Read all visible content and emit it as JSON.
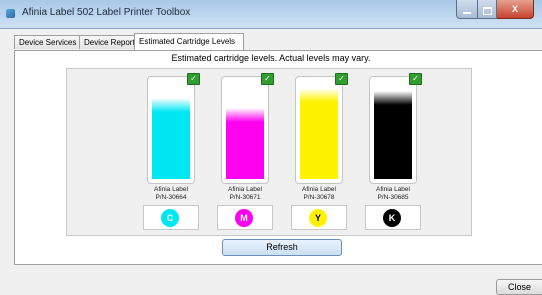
{
  "window": {
    "title": "Afinia Label 502 Label Printer Toolbox",
    "minimize_label": "",
    "maximize_label": "",
    "close_glyph": "X"
  },
  "tabs": [
    {
      "label": "Device Services",
      "active": false
    },
    {
      "label": "Device Reports",
      "active": false
    },
    {
      "label": "Estimated Cartridge Levels",
      "active": true
    }
  ],
  "main": {
    "subtitle": "Estimated cartridge levels.  Actual levels may vary."
  },
  "cartridges": [
    {
      "name": "Afinia Label",
      "part": "P/N-30664",
      "letter": "C",
      "color": "#00e7f3",
      "level": 0.83,
      "ok_mark": "✓"
    },
    {
      "name": "Afinia Label",
      "part": "P/N-30671",
      "letter": "M",
      "color": "#ff00f0",
      "level": 0.72,
      "ok_mark": "✓"
    },
    {
      "name": "Afinia Label",
      "part": "P/N-30678",
      "letter": "Y",
      "color": "#fff200",
      "level": 0.93,
      "ok_mark": "✓"
    },
    {
      "name": "Afinia Label",
      "part": "P/N-30685",
      "letter": "K",
      "color": "#000000",
      "level": 0.9,
      "ok_mark": "✓"
    }
  ],
  "buttons": {
    "refresh_label": "Refresh",
    "close_label": "Close"
  }
}
